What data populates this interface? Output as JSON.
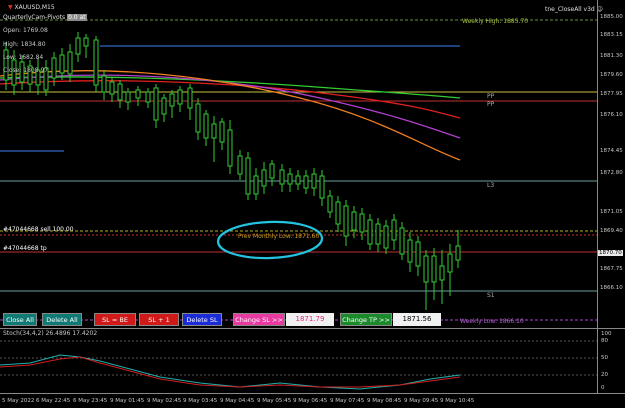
{
  "chart": {
    "symbol": "XAUUSD,M15",
    "indicator_name": "QuarterlyCam-Pivots",
    "indicator_tag": "0.0 at",
    "ea_label": "tne_CloseAll v3d",
    "info": {
      "open": "Open: 1769.08",
      "high": "High: 1834.80",
      "low": "Low: 1682.84",
      "close": "Close: 1808.97"
    },
    "price_axis": [
      "1885.00",
      "1883.15",
      "1881.30",
      "1879.60",
      "1877.95",
      "1876.10",
      "1874.45",
      "1872.80",
      "1871.05",
      "1869.40",
      "1867.75",
      "1866.10"
    ],
    "current_price": "1870.70",
    "level_labels": {
      "weekly_high": "Weekly High: 1885.70",
      "weekly_low": "Weekly Low: 1866.10",
      "pp1": "PP",
      "pp2": "PP",
      "l3": "L3",
      "s1": "S1",
      "prev_monthly_low": "Prev Monthly Low: 1871.60",
      "order_sl": "#47044668 sell 100.00",
      "order_tp": "#47044668 tp"
    },
    "colors": {
      "ma_green": "#33cc33",
      "ma_red": "#e02020",
      "ma_purple": "#b040d0",
      "ma_orange": "#f08020",
      "candle": "#33cc33",
      "annotation_circle": "#22c4e0"
    }
  },
  "stoch": {
    "label": "Stoch(34,4,2) 26.4896 17.4202",
    "axis": [
      "100",
      "80",
      "50",
      "20",
      "0"
    ]
  },
  "time_axis": [
    "5 May 2022",
    "6 May 22:45",
    "6 May 23:45",
    "9 May 01:45",
    "9 May 02:45",
    "9 May 03:45",
    "9 May 04:45",
    "9 May 05:45",
    "9 May 06:45",
    "9 May 07:45",
    "9 May 08:45",
    "9 May 09:45",
    "9 May 10:45"
  ],
  "toolbar": {
    "close_all": "Close All",
    "delete_all": "Delete All",
    "sl_be": "SL = BE",
    "sl_plus1": "SL + 1",
    "delete_sl": "Delete SL",
    "change_sl": "Change SL >>",
    "sl_value": "1871.79",
    "change_tp": "Change TP >>",
    "tp_value": "1871.56"
  }
}
